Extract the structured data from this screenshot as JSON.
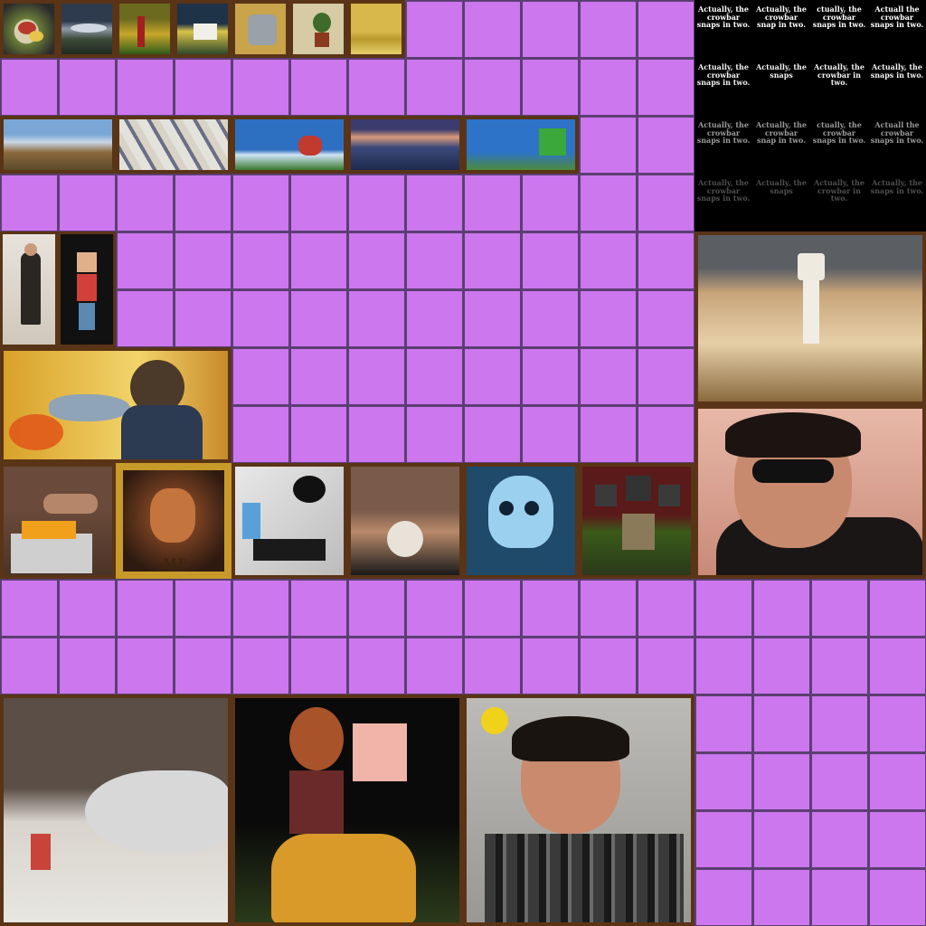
{
  "texture": {
    "grid_color": "#5b3f72",
    "empty_color": "#cc77ee",
    "frame_color": "#5a3416"
  },
  "crowbar_text": {
    "rows": [
      [
        "Actually, the crowbar snaps in two.",
        "Actually, the crowbar snap in two.",
        "ctually, the crowbar snaps in two.",
        "Actuall the crowbar snaps in two."
      ],
      [
        "Actually, the crowbar snaps in two.",
        "Actually, the snaps",
        "Actually, the crowbar in two.",
        "Actually, the snaps in two."
      ]
    ]
  },
  "paintings": [
    {
      "name": "painting-food-plate"
    },
    {
      "name": "painting-stormy-landscape"
    },
    {
      "name": "painting-yellow-field"
    },
    {
      "name": "painting-sunset-house"
    },
    {
      "name": "painting-kettle"
    },
    {
      "name": "painting-potted-plant"
    },
    {
      "name": "painting-yellow-landscape"
    },
    {
      "name": "painting-village-panorama"
    },
    {
      "name": "painting-white-debris"
    },
    {
      "name": "painting-sky-flowers"
    },
    {
      "name": "painting-purple-mountains"
    },
    {
      "name": "painting-creeper-sky"
    },
    {
      "name": "painting-man-portrait"
    },
    {
      "name": "painting-pinocchio"
    },
    {
      "name": "painting-skeleton-sofa"
    },
    {
      "name": "painting-rocket-man"
    },
    {
      "name": "painting-sunglasses-man"
    },
    {
      "name": "painting-hand-fire"
    },
    {
      "name": "painting-me-portrait"
    },
    {
      "name": "painting-spider-collage"
    },
    {
      "name": "painting-dream-collage"
    },
    {
      "name": "painting-blue-skull"
    },
    {
      "name": "painting-wither-heads"
    },
    {
      "name": "painting-pointing-hand"
    },
    {
      "name": "painting-girl-pig"
    },
    {
      "name": "painting-man-duck"
    }
  ],
  "me_label": "ME"
}
